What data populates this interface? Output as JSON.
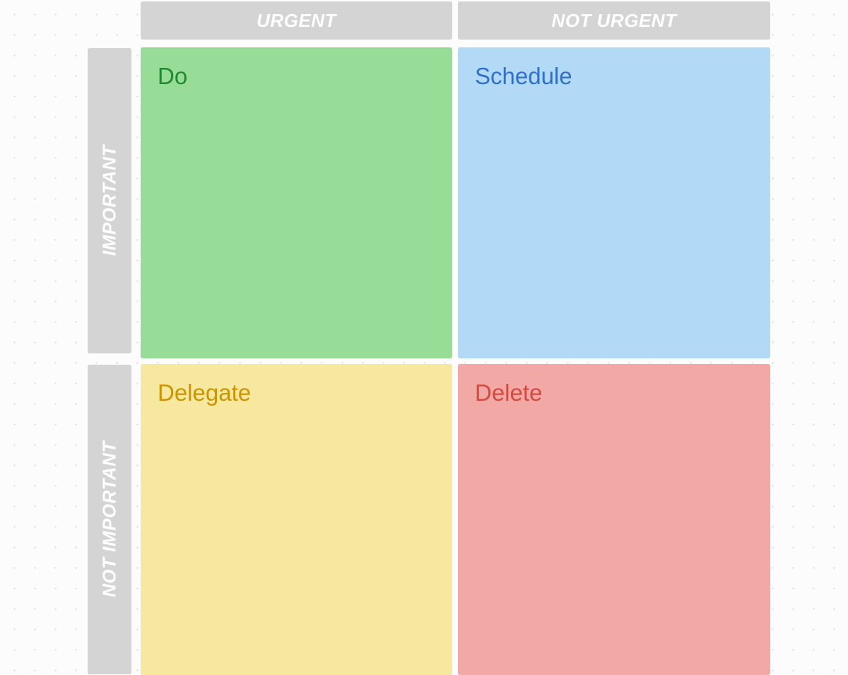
{
  "columns": {
    "urgent": "URGENT",
    "not_urgent": "NOT URGENT"
  },
  "rows": {
    "important": "IMPORTANT",
    "not_important": "NOT IMPORTANT"
  },
  "quadrants": {
    "do": {
      "title": "Do",
      "bg": "#97dd98",
      "fg": "#1f8a30"
    },
    "schedule": {
      "title": "Schedule",
      "bg": "#b2daf6",
      "fg": "#2f6fcf"
    },
    "delegate": {
      "title": "Delegate",
      "bg": "#f7e8a0",
      "fg": "#cc9400"
    },
    "delete": {
      "title": "Delete",
      "bg": "#f2a9a6",
      "fg": "#d54a3e"
    }
  }
}
